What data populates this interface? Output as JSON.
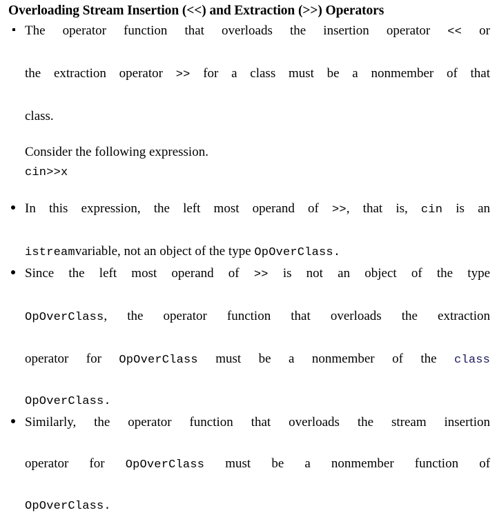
{
  "slide": {
    "title": "Overloading Stream Insertion (<<) and Extraction (>>) Operators",
    "background_color": "#ffffff",
    "text_color": "#000000",
    "code_accent_color": "#1a1a5e"
  },
  "bullet1": {
    "line1_a": "The operator function that overloads the insertion operator",
    "line1_code": "<<",
    "line1_b": "or",
    "line2_a": "the extraction operator",
    "line2_code": ">>",
    "line2_b": "for a class must be a nonmember of that",
    "line3": "class."
  },
  "consider": {
    "text": "Consider the following expression.",
    "expression": "cin>>x"
  },
  "bullet2": {
    "line1_a": "In this expression, the left most operand of",
    "line1_code1": ">>",
    "line1_b": ", that is,",
    "line1_code2": "cin",
    "line1_c": "is an",
    "line2_code1": "istream",
    "line2_a": "variable, not an object of the type",
    "line2_code2": "OpOverClass",
    "line2_b": "."
  },
  "bullet3": {
    "line1_a": "Since the left most operand of",
    "line1_code": ">>",
    "line1_b": "is not an object of the type",
    "line2_code": "OpOverClass",
    "line2_a": ", the operator function that overloads the extraction",
    "line3_a": "operator for",
    "line3_code1": "OpOverClass",
    "line3_b": "must be a nonmember of the",
    "line3_code2": "class",
    "line4_code": "OpOverClass."
  },
  "bullet4": {
    "line1": "Similarly, the operator function that overloads the stream insertion",
    "line2_a": "operator for",
    "line2_code": "OpOverClass",
    "line2_b": "must be a nonmember  function of",
    "line3_code": "OpOverClass."
  }
}
